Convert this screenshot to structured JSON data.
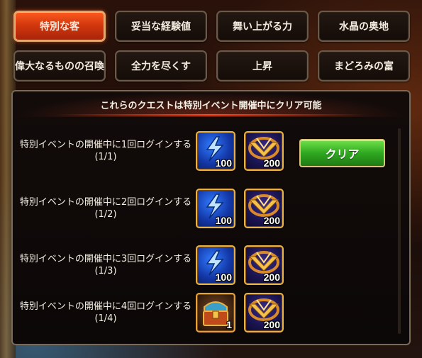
{
  "tabs": [
    {
      "label": "特別な客",
      "active": true
    },
    {
      "label": "妥当な経験値",
      "active": false
    },
    {
      "label": "舞い上がる力",
      "active": false
    },
    {
      "label": "水晶の奥地",
      "active": false
    },
    {
      "label": "偉大なるものの召喚",
      "active": false
    },
    {
      "label": "全力を尽くす",
      "active": false
    },
    {
      "label": "上昇",
      "active": false
    },
    {
      "label": "まどろみの富",
      "active": false
    }
  ],
  "panel": {
    "header": "これらのクエストは特別イベント開催中にクリア可能",
    "clear_label": "クリア"
  },
  "quests": [
    {
      "text": "特別イベントの開催中に1回ログインする",
      "progress": "(1/1)",
      "rewards": [
        {
          "icon": "energy-lightning-icon",
          "qty": "100"
        },
        {
          "icon": "golden-wings-emblem-icon",
          "qty": "200"
        }
      ]
    },
    {
      "text": "特別イベントの開催中に2回ログインする",
      "progress": "(1/2)",
      "rewards": [
        {
          "icon": "energy-lightning-icon",
          "qty": "100"
        },
        {
          "icon": "golden-wings-emblem-icon",
          "qty": "200"
        }
      ]
    },
    {
      "text": "特別イベントの開催中に3回ログインする",
      "progress": "(1/3)",
      "rewards": [
        {
          "icon": "energy-lightning-icon",
          "qty": "100"
        },
        {
          "icon": "golden-wings-emblem-icon",
          "qty": "200"
        }
      ]
    },
    {
      "text": "特別イベントの開催中に4回ログインする",
      "progress": "(1/4)",
      "rewards": [
        {
          "icon": "treasure-chest-icon",
          "qty": "1"
        },
        {
          "icon": "golden-wings-emblem-icon",
          "qty": "200"
        }
      ]
    }
  ],
  "colors": {
    "active_tab": "#d2380d",
    "tab_border": "#6b5a4a",
    "reward_border": "#e8b245",
    "clear_button": "#2fa820"
  }
}
